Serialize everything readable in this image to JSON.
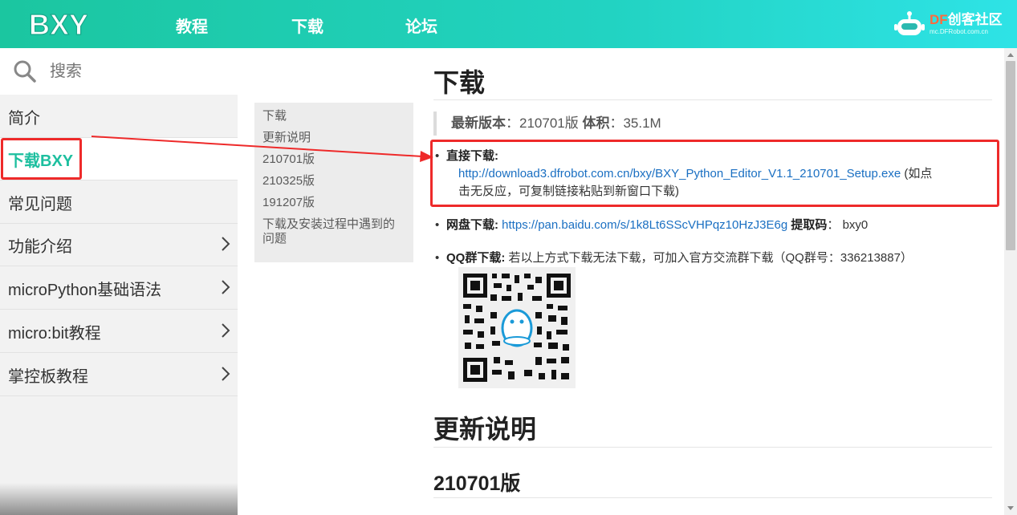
{
  "topnav": {
    "logo_text": "BXY",
    "links": [
      "教程",
      "下载",
      "论坛"
    ],
    "brand_df": "DF",
    "brand_name": "创客社区",
    "brand_sub": "mc.DFRobot.com.cn"
  },
  "search": {
    "placeholder": "搜索"
  },
  "sidebar": {
    "items": [
      {
        "label": "简介",
        "has_arrow": false
      },
      {
        "label": "下载BXY",
        "has_arrow": false,
        "active": true
      },
      {
        "label": "常见问题",
        "has_arrow": false
      },
      {
        "label": "功能介绍",
        "has_arrow": true
      },
      {
        "label": "microPython基础语法",
        "has_arrow": true
      },
      {
        "label": "micro:bit教程",
        "has_arrow": true
      },
      {
        "label": "掌控板教程",
        "has_arrow": true
      }
    ]
  },
  "toc": {
    "items": [
      "下载",
      "更新说明",
      "210701版",
      "210325版",
      "191207版",
      "下载及安装过程中遇到的问题"
    ]
  },
  "main": {
    "title": "下载",
    "version_label": "最新版本",
    "version_value": "210701版",
    "size_label": "体积",
    "size_value": "35.1M",
    "direct_label": "直接下载:",
    "direct_url": "http://download3.dfrobot.com.cn/bxy/BXY_Python_Editor_V1.1_210701_Setup.exe",
    "direct_note_1": " (如点",
    "direct_note_2": "击无反应，可复制链接粘贴到新窗口下载)",
    "pan_label": "网盘下载:",
    "pan_url": "https://pan.baidu.com/s/1k8Lt6SScVHPqz10HzJ3E6g",
    "pan_code_label": "提取码",
    "pan_code": "bxy0",
    "qq_label": "QQ群下载:",
    "qq_text": "若以上方式下载无法下载，可加入官方交流群下载（QQ群号：336213887）",
    "section_updates": "更新说明",
    "section_version": "210701版"
  },
  "colors": {
    "accent": "#1dbf9f",
    "annotation_red": "#ee2a2a",
    "link": "#1a6fc2"
  }
}
